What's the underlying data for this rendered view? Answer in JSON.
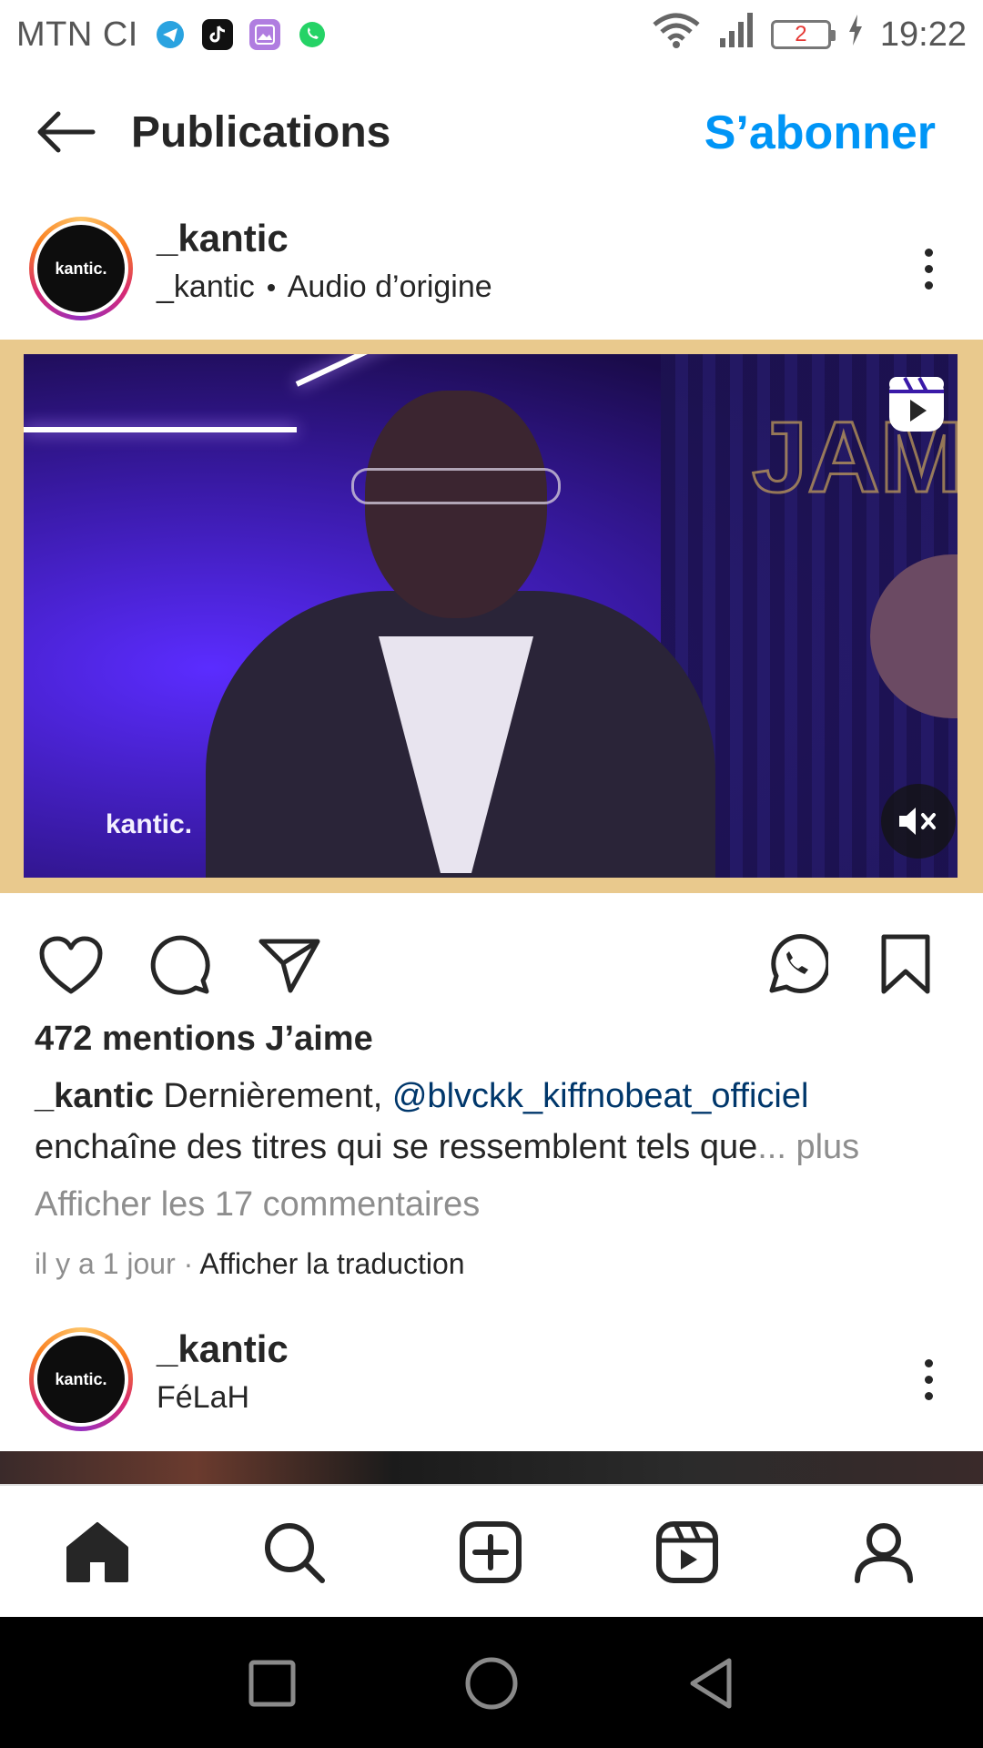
{
  "status_bar": {
    "carrier": "MTN CI",
    "battery_level": "2",
    "time": "19:22",
    "icons": [
      "telegram-icon",
      "tiktok-icon",
      "gallery-icon",
      "whatsapp-icon",
      "wifi-icon",
      "signal-icon",
      "battery-icon",
      "charging-icon"
    ]
  },
  "header": {
    "title": "Publications",
    "follow_label": "S’abonner"
  },
  "post1": {
    "avatar_text": "kantic.",
    "username": "_kantic",
    "sub_user": "_kantic",
    "audio": "Audio d’origine",
    "watermark": "kantic.",
    "likes": "472 mentions J’aime",
    "caption_user": "_kantic",
    "caption_text": " Dernièrement, ",
    "caption_mention": "@blvckk_kiffnobeat_officiel",
    "caption_text2": " enchaîne des titres qui se ressemblent tels que",
    "caption_more": "... plus",
    "comments": "Afficher les 17 commentaires",
    "time": "il y a 1 jour",
    "separator": " · ",
    "translate": "Afficher la traduction"
  },
  "post2": {
    "avatar_text": "kantic.",
    "username": "_kantic",
    "subtitle": "FéLaH"
  },
  "colors": {
    "accent": "#0095f6",
    "mention": "#00376b",
    "muted": "#8e8e8e",
    "text": "#262626"
  }
}
